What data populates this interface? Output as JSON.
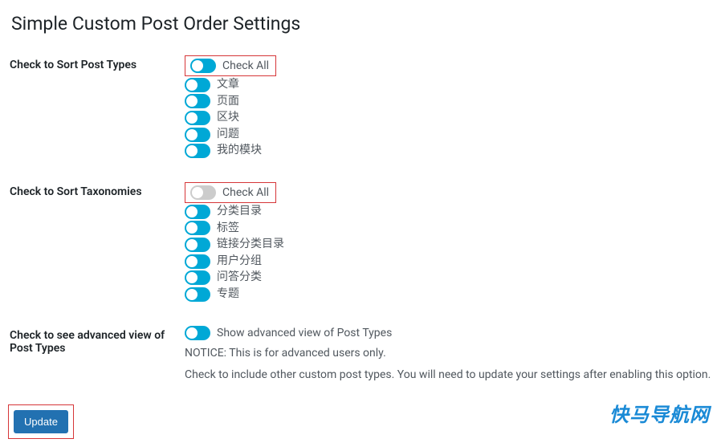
{
  "page": {
    "title": "Simple Custom Post Order Settings"
  },
  "sections": {
    "post_types": {
      "label": "Check to Sort Post Types",
      "check_all": {
        "label": "Check All",
        "on": true
      },
      "items": [
        {
          "label": "文章",
          "on": true
        },
        {
          "label": "页面",
          "on": true
        },
        {
          "label": "区块",
          "on": true
        },
        {
          "label": "问题",
          "on": true
        },
        {
          "label": "我的模块",
          "on": true
        }
      ]
    },
    "taxonomies": {
      "label": "Check to Sort Taxonomies",
      "check_all": {
        "label": "Check All",
        "on": false
      },
      "items": [
        {
          "label": "分类目录",
          "on": true
        },
        {
          "label": "标签",
          "on": true
        },
        {
          "label": "链接分类目录",
          "on": true
        },
        {
          "label": "用户分组",
          "on": true
        },
        {
          "label": "问答分类",
          "on": true
        },
        {
          "label": "专题",
          "on": true
        }
      ]
    },
    "advanced": {
      "label": "Check to see advanced view of Post Types",
      "toggle": {
        "label": "Show advanced view of Post Types",
        "on": true
      },
      "notice1": "NOTICE: This is for advanced users only.",
      "notice2": "Check to include other custom post types. You will need to update your settings after enabling this option."
    }
  },
  "submit": {
    "label": "Update"
  },
  "watermark": "快马导航网"
}
